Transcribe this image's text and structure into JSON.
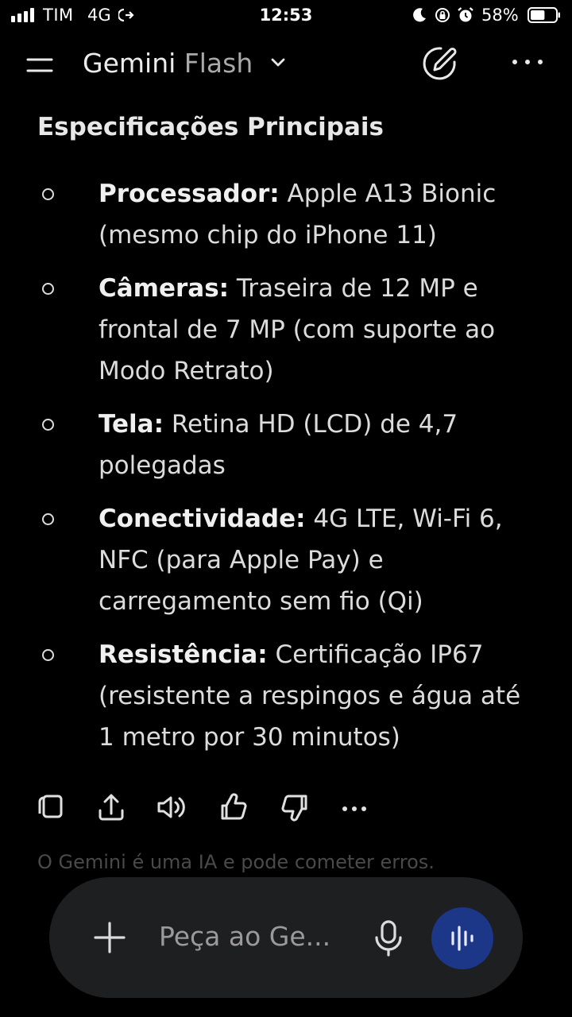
{
  "status_bar": {
    "carrier": "TIM",
    "network": "4G",
    "time": "12:53",
    "battery_percent": "58%",
    "battery_level": 0.58,
    "icons": [
      "signal-icon",
      "hotspot-icon",
      "moon-icon",
      "orientation-lock-icon",
      "alarm-icon",
      "battery-icon"
    ]
  },
  "header": {
    "app_name": "Gemini",
    "model": "Flash",
    "icons": [
      "menu-icon",
      "chevron-down-icon",
      "new-chat-icon",
      "more-icon"
    ]
  },
  "content": {
    "section_title": "Especificações Principais",
    "specs": [
      {
        "label": "Processador:",
        "text": " Apple A13 Bionic (mesmo chip do iPhone 11)"
      },
      {
        "label": "Câmeras:",
        "text": " Traseira de 12 MP e frontal de 7 MP (com suporte ao Modo Retrato)"
      },
      {
        "label": "Tela:",
        "text": " Retina HD (LCD) de 4,7 polegadas"
      },
      {
        "label": "Conectividade:",
        "text": " 4G LTE, Wi-Fi 6, NFC (para Apple Pay) e carregamento sem fio (Qi)"
      },
      {
        "label": "Resistência:",
        "text": " Certificação IP67 (resistente a respingos e água até 1 metro por 30 minutos)"
      }
    ]
  },
  "response_actions": [
    "copy-icon",
    "share-icon",
    "read-aloud-icon",
    "thumbs-up-icon",
    "thumbs-down-icon",
    "more-icon"
  ],
  "disclaimer": "O Gemini é uma IA e pode cometer erros.",
  "input": {
    "placeholder": "Peça ao Ge...",
    "icons": [
      "plus-icon",
      "microphone-icon",
      "live-icon"
    ]
  },
  "colors": {
    "background": "#000000",
    "input_bar": "#1e1f20",
    "live_button": "#1c3688",
    "text": "#dcdcdc",
    "muted": "#a9a9a9"
  }
}
